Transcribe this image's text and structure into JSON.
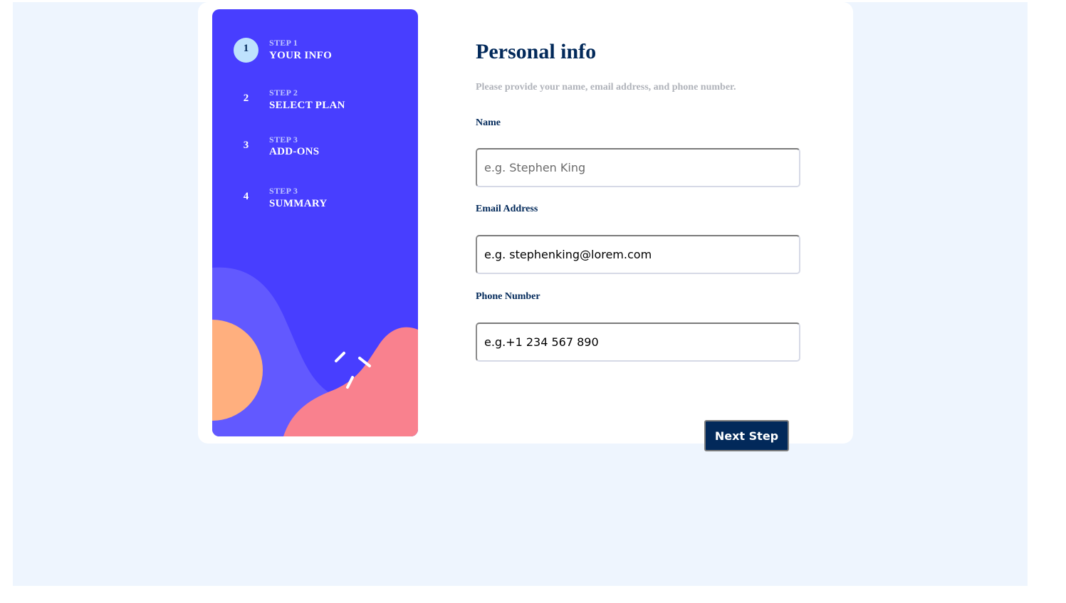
{
  "sidebar": {
    "steps": [
      {
        "number": "1",
        "label": "STEP 1",
        "title": "YOUR INFO",
        "active": true
      },
      {
        "number": "2",
        "label": "STEP 2",
        "title": "SELECT PLAN",
        "active": false
      },
      {
        "number": "3",
        "label": "STEP 3",
        "title": "ADD-ONS",
        "active": false
      },
      {
        "number": "4",
        "label": "STEP 3",
        "title": "SUMMARY",
        "active": false
      }
    ],
    "colors": {
      "background": "#483eff",
      "wave": "#6259ff",
      "circle": "#ffaf7e",
      "blob": "#f9818e",
      "active_step": "#bee2fd"
    }
  },
  "main": {
    "title": "Personal info",
    "subtitle": "Please provide your name, email address, and phone number.",
    "fields": {
      "name": {
        "label": "Name",
        "placeholder": "e.g. Stephen King",
        "value": ""
      },
      "email": {
        "label": "Email Address",
        "placeholder": "e.g. stephenking@lorem.com",
        "value": ""
      },
      "phone": {
        "label": "Phone Number",
        "placeholder": "e.g.+1 234 567 890",
        "value": ""
      }
    },
    "next_button_label": "Next Step"
  },
  "colors": {
    "page_background": "#eef5fe",
    "card_background": "#ffffff",
    "primary_text": "#02295a",
    "muted_text": "#b0b3ba",
    "button_background": "#02295a"
  }
}
